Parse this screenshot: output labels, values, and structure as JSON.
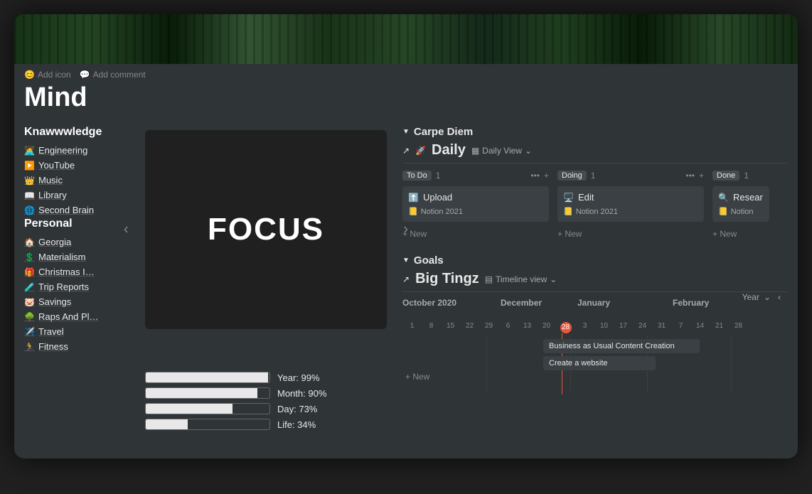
{
  "header": {
    "add_icon": "Add icon",
    "add_comment": "Add comment",
    "title": "Mind"
  },
  "knowledge": {
    "heading": "Knawwwledge",
    "items": [
      {
        "icon": "🧑‍💻",
        "label": "Engineering"
      },
      {
        "icon": "▶️",
        "label": "YouTube"
      },
      {
        "icon": "👑",
        "label": "Music"
      },
      {
        "icon": "📖",
        "label": "Library"
      },
      {
        "icon": "🌐",
        "label": "Second Brain"
      }
    ]
  },
  "personal": {
    "heading": "Personal",
    "items": [
      {
        "icon": "🏠",
        "label": "Georgia"
      },
      {
        "icon": "💲",
        "label": "Materialism"
      },
      {
        "icon": "🎁",
        "label": "Christmas I…"
      },
      {
        "icon": "🧪",
        "label": "Trip Reports"
      },
      {
        "icon": "🐷",
        "label": "Savings"
      },
      {
        "icon": "🌳",
        "label": "Raps And Pl…"
      },
      {
        "icon": "✈️",
        "label": "Travel"
      },
      {
        "icon": "🏃",
        "label": "Fitness"
      }
    ]
  },
  "focus": {
    "text": "FOCUS"
  },
  "progress": [
    {
      "label": "Year: 99%",
      "pct": 99
    },
    {
      "label": "Month: 90%",
      "pct": 90
    },
    {
      "label": "Day: 73%",
      "pct": 70
    },
    {
      "label": "Life: 34%",
      "pct": 34
    }
  ],
  "carpe": {
    "heading": "Carpe Diem",
    "db_icon": "🚀",
    "db_title": "Daily",
    "view": "Daily View",
    "columns": [
      {
        "name": "To Do",
        "count": 1,
        "card": {
          "icon": "⬆️",
          "title": "Upload",
          "tag_icon": "📒",
          "tag": "Notion 2021"
        }
      },
      {
        "name": "Doing",
        "count": 1,
        "card": {
          "icon": "🖥️",
          "title": "Edit",
          "tag_icon": "📒",
          "tag": "Notion 2021"
        }
      },
      {
        "name": "Done",
        "count": 1,
        "card": {
          "icon": "🔍",
          "title": "Resear",
          "tag_icon": "📒",
          "tag": "Notion"
        }
      }
    ],
    "new": "New"
  },
  "goals": {
    "heading": "Goals",
    "db_title": "Big Tingz",
    "view": "Timeline view",
    "months": [
      "October 2020",
      "December",
      "January",
      "February"
    ],
    "year_label": "Year",
    "days": [
      "1",
      "8",
      "15",
      "22",
      "29",
      "6",
      "13",
      "20",
      "28",
      "3",
      "10",
      "17",
      "24",
      "31",
      "7",
      "14",
      "21",
      "28"
    ],
    "today": "28",
    "bars": [
      {
        "text": "Business as Usual Content Creation"
      },
      {
        "text": "Create a website"
      }
    ],
    "new": "New"
  }
}
